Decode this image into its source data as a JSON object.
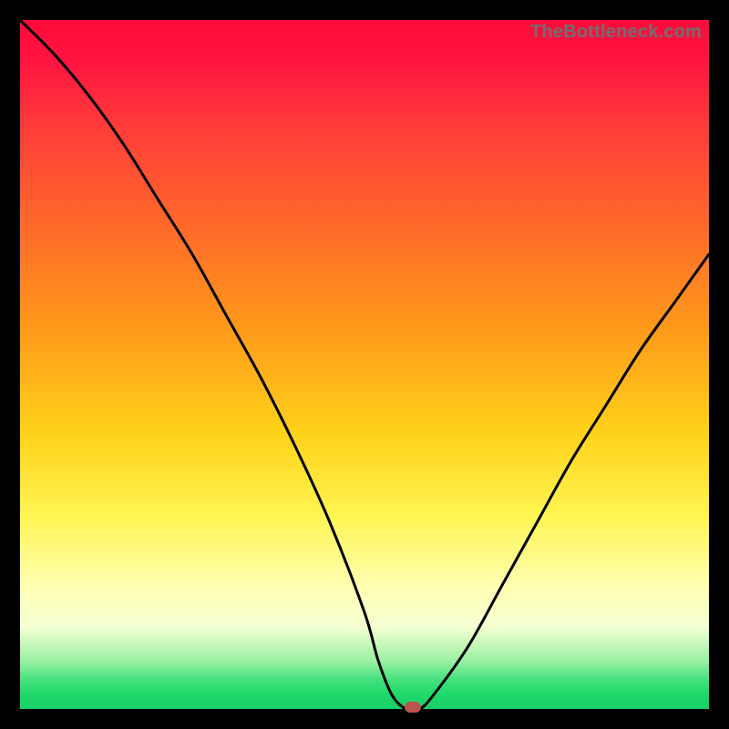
{
  "watermark": "TheBottleneck.com",
  "marker_color": "#b8554e",
  "curve_color": "#000000",
  "curve_stroke_width": 3,
  "chart_data": {
    "type": "line",
    "title": "",
    "xlabel": "",
    "ylabel": "",
    "xlim": [
      0,
      100
    ],
    "ylim": [
      0,
      100
    ],
    "grid": false,
    "legend": false,
    "series": [
      {
        "name": "bottleneck-curve",
        "x": [
          0,
          5,
          10,
          15,
          20,
          25,
          30,
          35,
          40,
          45,
          50,
          52,
          54,
          56,
          58,
          60,
          65,
          70,
          75,
          80,
          85,
          90,
          95,
          100
        ],
        "y": [
          100,
          95,
          89,
          82,
          74,
          66,
          57,
          48,
          38,
          27,
          14,
          7,
          2,
          0,
          0,
          2,
          9,
          18,
          27,
          36,
          44,
          52,
          59,
          66
        ]
      }
    ],
    "markers": [
      {
        "name": "bottleneck-point",
        "x": 57,
        "y": 0.3
      }
    ]
  }
}
